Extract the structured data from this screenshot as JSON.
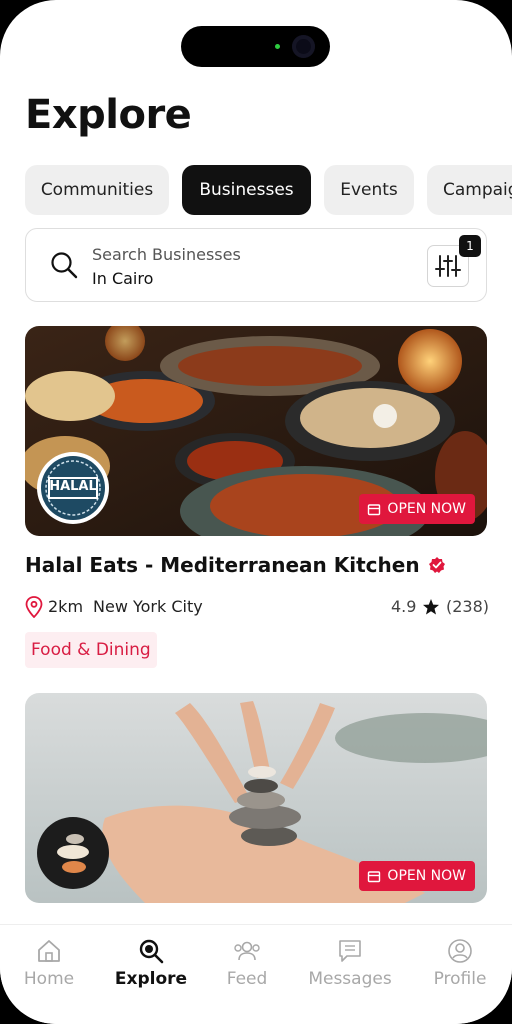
{
  "header": {
    "title": "Explore"
  },
  "tabs": [
    {
      "label": "Communities"
    },
    {
      "label": "Businesses"
    },
    {
      "label": "Events"
    },
    {
      "label": "Campaigns"
    }
  ],
  "search": {
    "placeholder": "Search Businesses",
    "location": "In Cairo",
    "filter_count": "1"
  },
  "cards": [
    {
      "status": "OPEN NOW",
      "logo_text": "HALAL",
      "name": "Halal Eats - Mediterranean Kitchen",
      "distance": "2km",
      "city": "New York City",
      "rating": "4.9",
      "reviews": "(238)",
      "category": "Food & Dining"
    },
    {
      "status": "OPEN NOW"
    }
  ],
  "nav": {
    "items": [
      {
        "label": "Home"
      },
      {
        "label": "Explore"
      },
      {
        "label": "Feed"
      },
      {
        "label": "Messages"
      },
      {
        "label": "Profile"
      }
    ]
  },
  "colors": {
    "accent": "#e0173d",
    "active_tab": "#111111",
    "tag_bg": "#fdeef1"
  }
}
